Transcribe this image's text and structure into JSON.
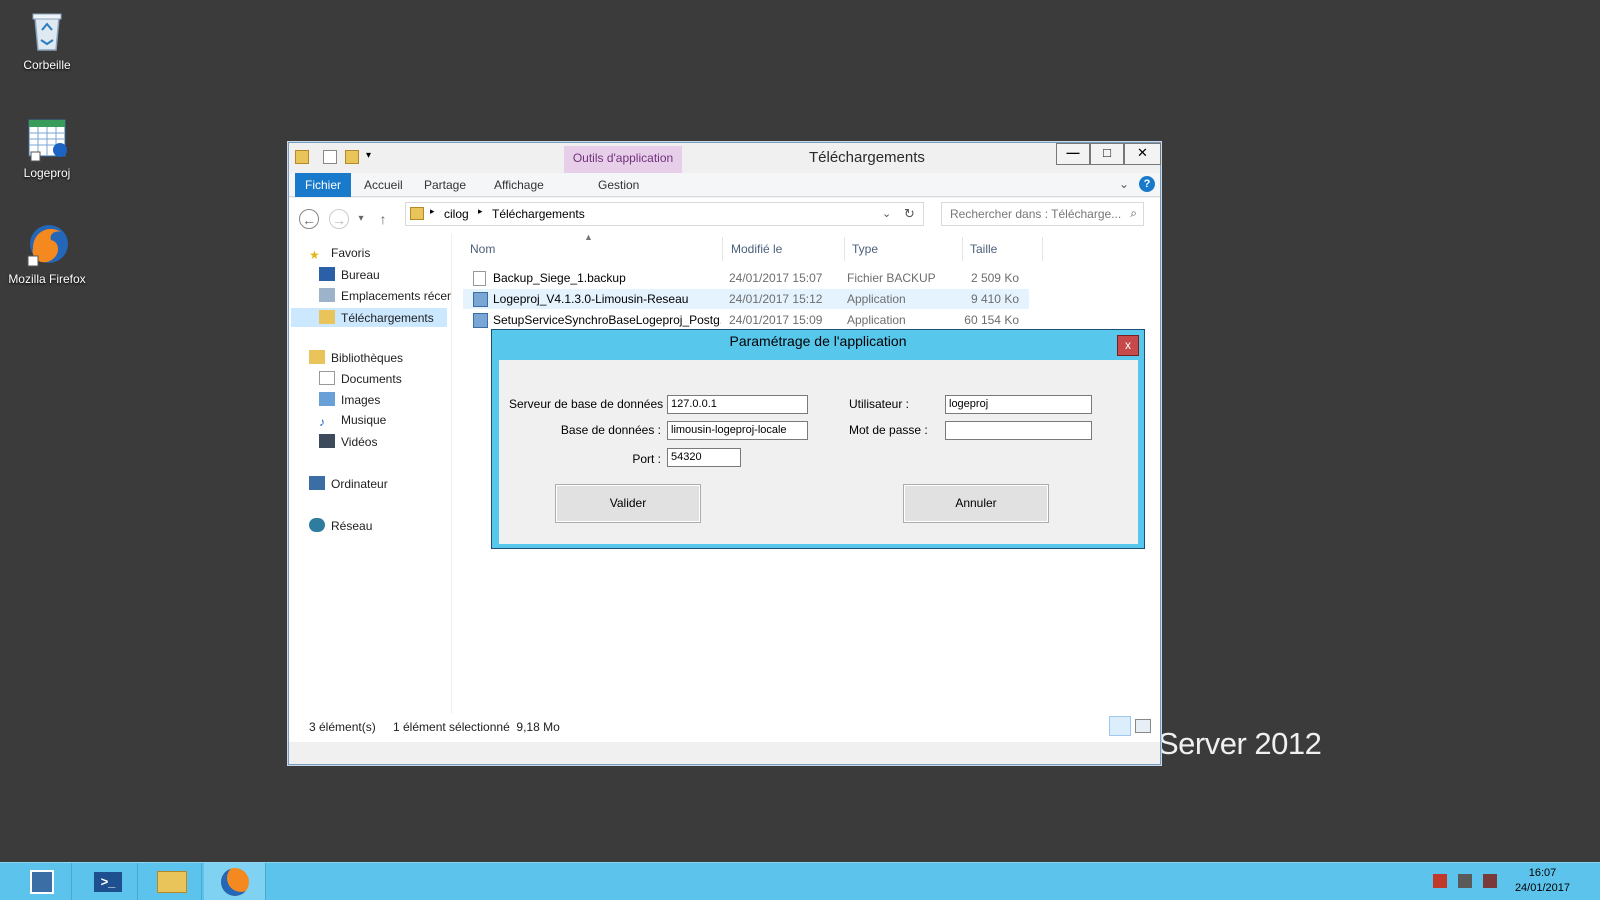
{
  "desktop": {
    "icons": [
      {
        "label": "Corbeille"
      },
      {
        "label": "Logeproj"
      },
      {
        "label": "Mozilla Firefox"
      }
    ],
    "brand": "Server 2012"
  },
  "explorer": {
    "title": "Téléchargements",
    "context_tab": "Outils d'application",
    "ribbon_tabs": [
      "Fichier",
      "Accueil",
      "Partage",
      "Affichage",
      "Gestion"
    ],
    "window_buttons": {
      "minimize": "—",
      "maximize": "□",
      "close": "✕"
    },
    "breadcrumb": [
      "cilog",
      "Téléchargements"
    ],
    "search_placeholder": "Rechercher dans : Télécharge...",
    "nav": {
      "favorites_label": "Favoris",
      "favorites": [
        "Bureau",
        "Emplacements récen",
        "Téléchargements"
      ],
      "libraries_label": "Bibliothèques",
      "libraries": [
        "Documents",
        "Images",
        "Musique",
        "Vidéos"
      ],
      "computer": "Ordinateur",
      "network": "Réseau"
    },
    "columns": [
      "Nom",
      "Modifié le",
      "Type",
      "Taille"
    ],
    "files": [
      {
        "name": "Backup_Siege_1.backup",
        "modified": "24/01/2017 15:07",
        "type": "Fichier BACKUP",
        "size": "2 509 Ko"
      },
      {
        "name": "Logeproj_V4.1.3.0-Limousin-Reseau",
        "modified": "24/01/2017 15:12",
        "type": "Application",
        "size": "9 410 Ko"
      },
      {
        "name": "SetupServiceSynchroBaseLogeproj_Postg...",
        "modified": "24/01/2017 15:09",
        "type": "Application",
        "size": "60 154 Ko"
      }
    ],
    "status": {
      "count": "3 élément(s)",
      "selection": "1 élément sélectionné  9,18 Mo"
    }
  },
  "dialog": {
    "title": "Paramétrage de l'application",
    "close": "x",
    "labels": {
      "server": "Serveur de base de données :",
      "database": "Base de données :",
      "port": "Port :",
      "user": "Utilisateur :",
      "password": "Mot de passe :"
    },
    "values": {
      "server": "127.0.0.1",
      "database": "limousin-logeproj-locale",
      "port": "54320",
      "user": "logeproj",
      "password": ""
    },
    "buttons": {
      "ok": "Valider",
      "cancel": "Annuler"
    }
  },
  "taskbar": {
    "time": "16:07",
    "date": "24/01/2017"
  }
}
